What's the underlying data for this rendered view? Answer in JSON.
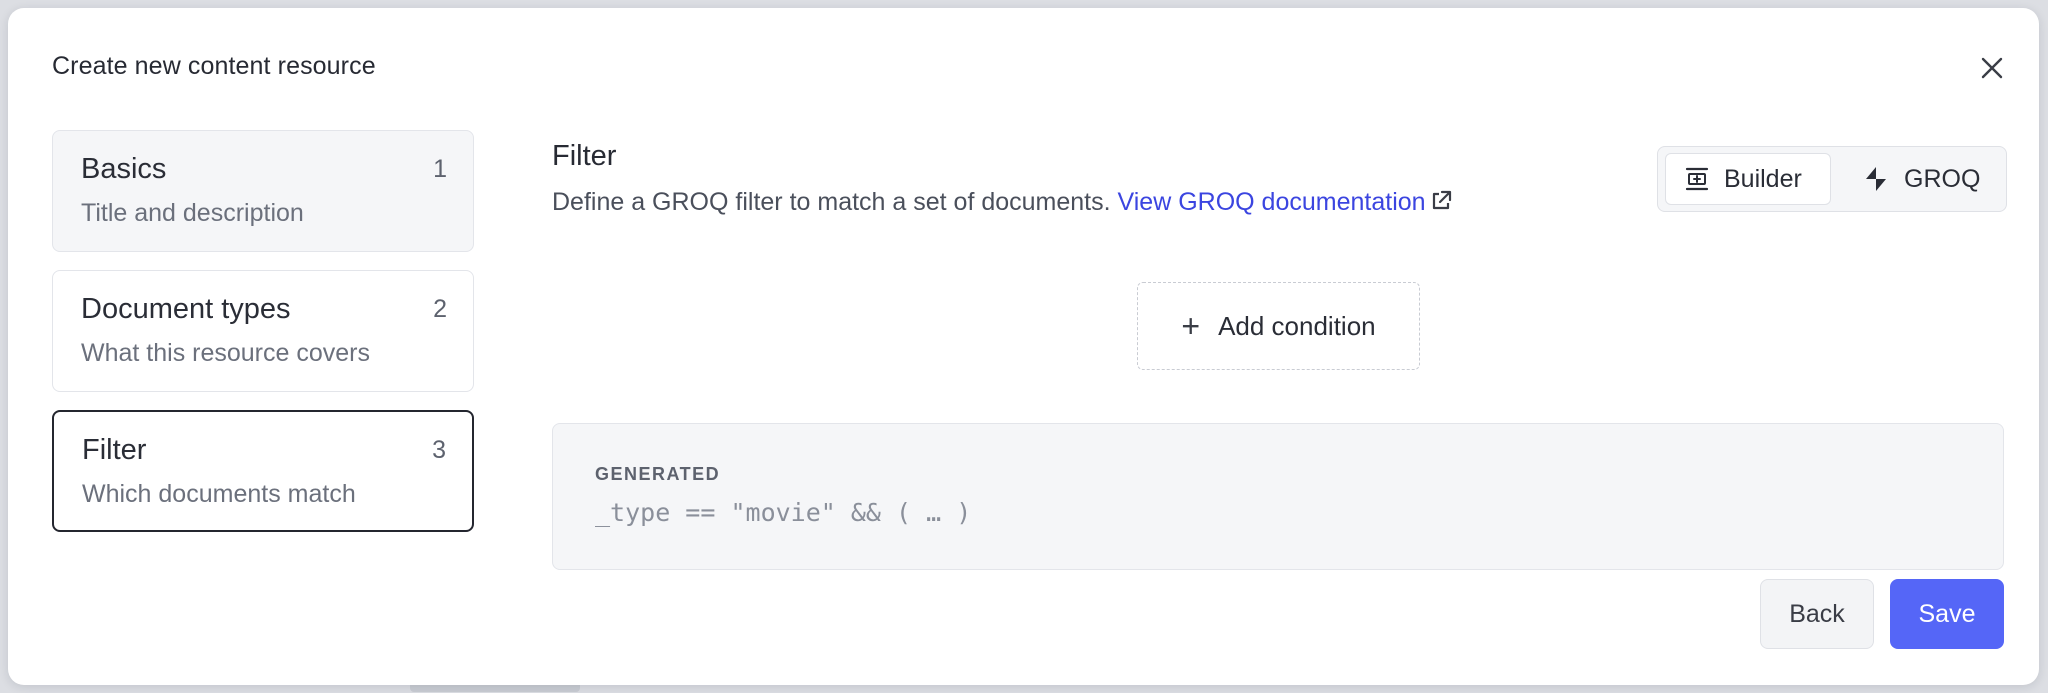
{
  "modal": {
    "title": "Create new content resource"
  },
  "steps": [
    {
      "title": "Basics",
      "num": "1",
      "sub": "Title and description",
      "state": "done"
    },
    {
      "title": "Document types",
      "num": "2",
      "sub": "What this resource covers",
      "state": "pending"
    },
    {
      "title": "Filter",
      "num": "3",
      "sub": "Which documents match",
      "state": "active"
    }
  ],
  "main": {
    "title": "Filter",
    "description": "Define a GROQ filter to match a set of documents.",
    "doc_link": "View GROQ documentation",
    "modes": {
      "builder_label": "Builder",
      "groq_label": "GROQ",
      "selected": "Builder"
    },
    "add_condition_label": "Add condition",
    "generated": {
      "label": "GENERATED",
      "code": "_type == \"movie\" && ( … )"
    }
  },
  "footer": {
    "back_label": "Back",
    "save_label": "Save"
  },
  "colors": {
    "accent": "#5566f7",
    "link": "#3b45e0"
  },
  "icons": {
    "close": "close-icon",
    "external_link": "external-link-icon",
    "builder": "builder-icon",
    "groq": "groq-icon",
    "add": "plus-icon"
  }
}
